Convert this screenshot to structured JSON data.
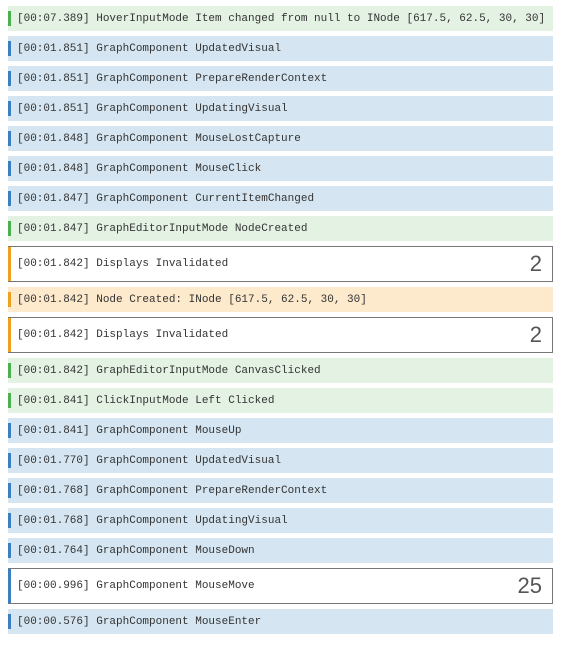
{
  "colors": {
    "blue": "#3a7fbf",
    "green": "#4caf50",
    "orange": "#f0a020",
    "blue_bg": "#d5e6f2",
    "green_bg": "#e4f2e4",
    "orange_bg": "#fde9cc",
    "border_gray": "#777"
  },
  "entries": [
    {
      "ts": "00:07.389",
      "text": "HoverInputMode Item changed from null to INode [617.5, 62.5, 30, 30]",
      "bar": "green",
      "bg": "green-bg",
      "bordered": false
    },
    {
      "ts": "00:01.851",
      "text": "GraphComponent UpdatedVisual",
      "bar": "blue",
      "bg": "blue-bg",
      "bordered": false
    },
    {
      "ts": "00:01.851",
      "text": "GraphComponent PrepareRenderContext",
      "bar": "blue",
      "bg": "blue-bg",
      "bordered": false
    },
    {
      "ts": "00:01.851",
      "text": "GraphComponent UpdatingVisual",
      "bar": "blue",
      "bg": "blue-bg",
      "bordered": false
    },
    {
      "ts": "00:01.848",
      "text": "GraphComponent MouseLostCapture",
      "bar": "blue",
      "bg": "blue-bg",
      "bordered": false
    },
    {
      "ts": "00:01.848",
      "text": "GraphComponent MouseClick",
      "bar": "blue",
      "bg": "blue-bg",
      "bordered": false
    },
    {
      "ts": "00:01.847",
      "text": "GraphComponent CurrentItemChanged",
      "bar": "blue",
      "bg": "blue-bg",
      "bordered": false
    },
    {
      "ts": "00:01.847",
      "text": "GraphEditorInputMode NodeCreated",
      "bar": "green",
      "bg": "green-bg",
      "bordered": false
    },
    {
      "ts": "00:01.842",
      "text": "Displays Invalidated",
      "bar": "orange",
      "bg": "white-bg",
      "bordered": true,
      "count": 2
    },
    {
      "ts": "00:01.842",
      "text": "Node Created: INode [617.5, 62.5, 30, 30]",
      "bar": "orange",
      "bg": "orange-bg",
      "bordered": false
    },
    {
      "ts": "00:01.842",
      "text": "Displays Invalidated",
      "bar": "orange",
      "bg": "white-bg",
      "bordered": true,
      "count": 2
    },
    {
      "ts": "00:01.842",
      "text": "GraphEditorInputMode CanvasClicked",
      "bar": "green",
      "bg": "green-bg",
      "bordered": false
    },
    {
      "ts": "00:01.841",
      "text": "ClickInputMode Left Clicked",
      "bar": "green",
      "bg": "green-bg",
      "bordered": false
    },
    {
      "ts": "00:01.841",
      "text": "GraphComponent MouseUp",
      "bar": "blue",
      "bg": "blue-bg",
      "bordered": false
    },
    {
      "ts": "00:01.770",
      "text": "GraphComponent UpdatedVisual",
      "bar": "blue",
      "bg": "blue-bg",
      "bordered": false
    },
    {
      "ts": "00:01.768",
      "text": "GraphComponent PrepareRenderContext",
      "bar": "blue",
      "bg": "blue-bg",
      "bordered": false
    },
    {
      "ts": "00:01.768",
      "text": "GraphComponent UpdatingVisual",
      "bar": "blue",
      "bg": "blue-bg",
      "bordered": false
    },
    {
      "ts": "00:01.764",
      "text": "GraphComponent MouseDown",
      "bar": "blue",
      "bg": "blue-bg",
      "bordered": false
    },
    {
      "ts": "00:00.996",
      "text": "GraphComponent MouseMove",
      "bar": "blue",
      "bg": "white-bg",
      "bordered": true,
      "count": 25
    },
    {
      "ts": "00:00.576",
      "text": "GraphComponent MouseEnter",
      "bar": "blue",
      "bg": "blue-bg",
      "bordered": false
    }
  ]
}
